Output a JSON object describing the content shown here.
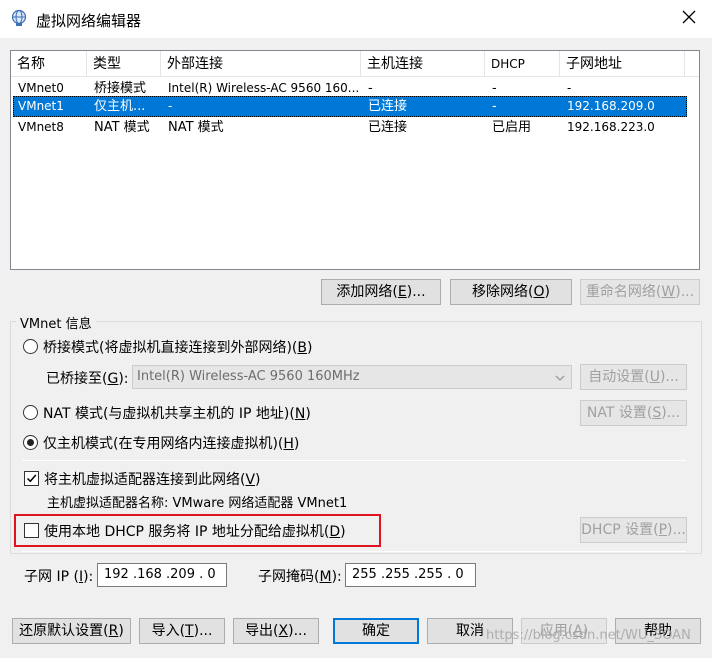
{
  "window": {
    "title": "虚拟网络编辑器",
    "icon": "network-globe-icon",
    "close_icon": "close-icon"
  },
  "table": {
    "columns": [
      "名称",
      "类型",
      "外部连接",
      "主机连接",
      "DHCP",
      "子网地址"
    ],
    "rows": [
      {
        "name": "VMnet0",
        "type": "桥接模式",
        "external": "Intel(R) Wireless-AC 9560 160...",
        "host": "-",
        "dhcp": "-",
        "subnet": "-"
      },
      {
        "name": "VMnet1",
        "type": "仅主机...",
        "external": "-",
        "host": "已连接",
        "dhcp": "-",
        "subnet": "192.168.209.0"
      },
      {
        "name": "VMnet8",
        "type": "NAT 模式",
        "external": "NAT 模式",
        "host": "已连接",
        "dhcp": "已启用",
        "subnet": "192.168.223.0"
      }
    ],
    "selected_row": 1
  },
  "table_buttons": {
    "add_pre": "添加网络(",
    "add_key": "E",
    "add_post": ")...",
    "remove_pre": "移除网络(",
    "remove_key": "O",
    "remove_post": ")",
    "rename_pre": "重命名网络(",
    "rename_key": "W",
    "rename_post": ")..."
  },
  "vmnet_info": {
    "group_title": "VMnet 信息",
    "bridged_pre": "桥接模式(将虚拟机直接连接到外部网络)(",
    "bridged_key": "B",
    "bridged_post": ")",
    "bridged_to_pre": "已桥接至(",
    "bridged_to_key": "G",
    "bridged_to_post": "):",
    "bridged_adapter_value": "Intel(R) Wireless-AC 9560 160MHz",
    "auto_pre": "自动设置(",
    "auto_key": "U",
    "auto_post": ")...",
    "nat_pre": "NAT 模式(与虚拟机共享主机的 IP 地址)(",
    "nat_key": "N",
    "nat_post": ")",
    "nat_settings_pre": "NAT 设置(",
    "nat_settings_key": "S",
    "nat_settings_post": ")...",
    "hostonly_pre": "仅主机模式(在专用网络内连接虚拟机)(",
    "hostonly_key": "H",
    "hostonly_post": ")",
    "selected_mode": "hostonly",
    "connect_adapter_pre": "将主机虚拟适配器连接到此网络(",
    "connect_adapter_key": "V",
    "connect_adapter_post": ")",
    "connect_adapter_checked": true,
    "adapter_name_line": "主机虚拟适配器名称: VMware 网络适配器 VMnet1",
    "dhcp_pre": "使用本地 DHCP 服务将 IP 地址分配给虚拟机(",
    "dhcp_key": "D",
    "dhcp_post": ")",
    "dhcp_checked": false,
    "dhcp_settings_pre": "DHCP 设置(",
    "dhcp_settings_key": "P",
    "dhcp_settings_post": ")...",
    "subnet_ip_pre": "子网 IP (",
    "subnet_ip_key": "I",
    "subnet_ip_post": "):",
    "subnet_ip_value": "192 .168 .209 . 0",
    "subnet_mask_pre": "子网掩码(",
    "subnet_mask_key": "M",
    "subnet_mask_post": "):",
    "subnet_mask_value": "255 .255 .255 . 0"
  },
  "bottom_buttons": {
    "restore_pre": "还原默认设置(",
    "restore_key": "R",
    "restore_post": ")",
    "import_pre": "导入(",
    "import_key": "T",
    "import_post": ")...",
    "export_pre": "导出(",
    "export_key": "X",
    "export_post": ")...",
    "ok": "确定",
    "cancel": "取消",
    "apply_pre": "应用(",
    "apply_key": "A",
    "apply_post": ")",
    "help": "帮助"
  },
  "watermark": "https://blog.csdn.net/WU_SOAN",
  "colors": {
    "selection": "#0078d7",
    "highlight_box": "#e0141e"
  }
}
